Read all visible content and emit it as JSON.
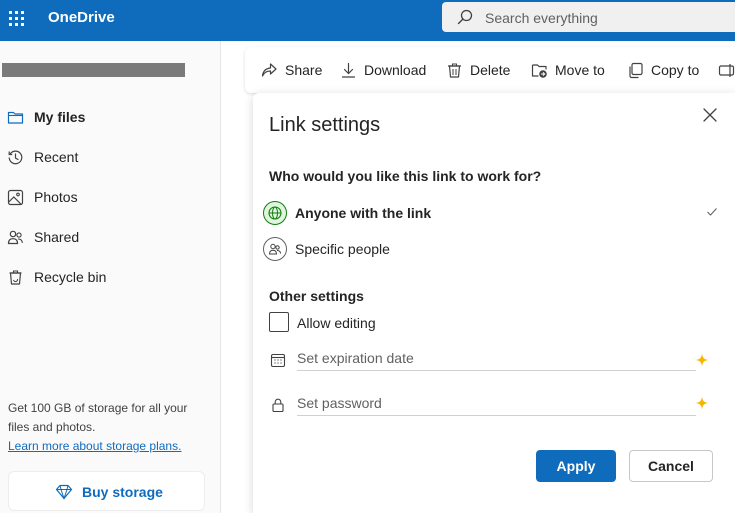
{
  "app": {
    "title": "OneDrive",
    "brand_color": "#0f6cbd",
    "waffle_icon": "app-launcher-icon"
  },
  "search": {
    "placeholder": "Search everything",
    "icon": "search-icon"
  },
  "sidebar": {
    "items": [
      {
        "label": "My files",
        "icon": "folder-icon",
        "active": true
      },
      {
        "label": "Recent",
        "icon": "history-icon",
        "active": false
      },
      {
        "label": "Photos",
        "icon": "image-icon",
        "active": false
      },
      {
        "label": "Shared",
        "icon": "people-icon",
        "active": false
      },
      {
        "label": "Recycle bin",
        "icon": "recycle-bin-icon",
        "active": false
      }
    ],
    "storage_text": "Get 100 GB of storage for all your files and photos.",
    "storage_link": "Learn more about storage plans.",
    "buy_label": "Buy storage",
    "buy_icon": "diamond-icon"
  },
  "commandbar": {
    "items": [
      {
        "label": "Share",
        "icon": "share-icon"
      },
      {
        "label": "Download",
        "icon": "download-icon"
      },
      {
        "label": "Delete",
        "icon": "trash-icon"
      },
      {
        "label": "Move to",
        "icon": "move-folder-icon"
      },
      {
        "label": "Copy to",
        "icon": "copy-icon"
      }
    ]
  },
  "dialog": {
    "title": "Link settings",
    "question": "Who would you like this link to work for?",
    "options": [
      {
        "label": "Anyone with the link",
        "icon": "globe-icon",
        "selected": true
      },
      {
        "label": "Specific people",
        "icon": "people-icon",
        "selected": false
      }
    ],
    "other_settings": "Other settings",
    "allow_editing": "Allow editing",
    "allow_editing_checked": false,
    "expiration_placeholder": "Set expiration date",
    "password_placeholder": "Set password",
    "premium_color": "#f7b500",
    "apply_label": "Apply",
    "cancel_label": "Cancel"
  }
}
